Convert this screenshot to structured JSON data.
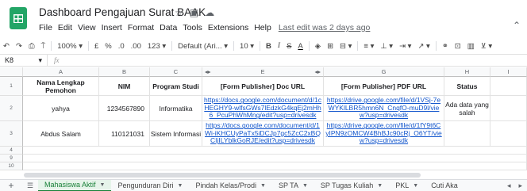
{
  "doc": {
    "title": "Dashboard Pengajuan Surat BAAK",
    "last_edit": "Last edit was 2 days ago"
  },
  "menu": [
    "File",
    "Edit",
    "View",
    "Insert",
    "Format",
    "Data",
    "Tools",
    "Extensions",
    "Help"
  ],
  "toolbar": {
    "zoom": "100%",
    "currency": "£",
    "percent": "%",
    "dec_less": ".0",
    "dec_more": ".00",
    "format_more": "123",
    "font": "Default (Ari...",
    "font_size": "10"
  },
  "formula": {
    "cell_ref": "K8",
    "fx": "fx"
  },
  "columns": [
    "A",
    "B",
    "C",
    "",
    "E",
    "",
    "G",
    "H",
    "I"
  ],
  "rows": [
    "1",
    "2",
    "3",
    "4",
    "9",
    "10"
  ],
  "headers": {
    "nama": "Nama Lengkap Pemohon",
    "nim": "NIM",
    "prodi": "Program Studi",
    "doc_url": "[Form Publisher] Doc URL",
    "pdf_url": "[Form Publisher] PDF URL",
    "status": "Status"
  },
  "records": [
    {
      "nama": "yahya",
      "nim": "1234567890",
      "prodi": "Informatika",
      "doc_url": "https://docs.google.com/document/d/1cHEGHY9-wlfsGWs7lEdzkG4kqEj2mHh6_PcuPhWhMng/edit?usp=drivesdk",
      "pdf_url": "https://drive.google.com/file/d/1VSj-7eWYKlLBR5hmn6N_CnqfO-muD9l/view?usp=drivesdk",
      "status": "Ada data yang salah"
    },
    {
      "nama": "Abdus Salam",
      "nim": "110121031",
      "prodi": "Sistem Informasi",
      "doc_url": "https://docs.google.com/document/d/1Wi-iKHCUyPaTx5iDCJp7gc5ZcC2xBQCIjILYblkGoRJE/edit?usp=drivesdk",
      "pdf_url": "https://drive.google.com/file/d/1fY9t6CyIPN9zOMCW4BhBJc90cRj_O6YT/view?usp=drivesdk",
      "status": ""
    }
  ],
  "tabs": [
    "Mahasiswa Aktif",
    "Pengunduran Diri",
    "Pindah Kelas/Prodi",
    "SP TA",
    "SP Tugas Kuliah",
    "PKL",
    "Cuti Aka"
  ],
  "colors": {
    "link": "#1155cc",
    "active_tab": "#188038",
    "sheets_green": "#23a566"
  }
}
